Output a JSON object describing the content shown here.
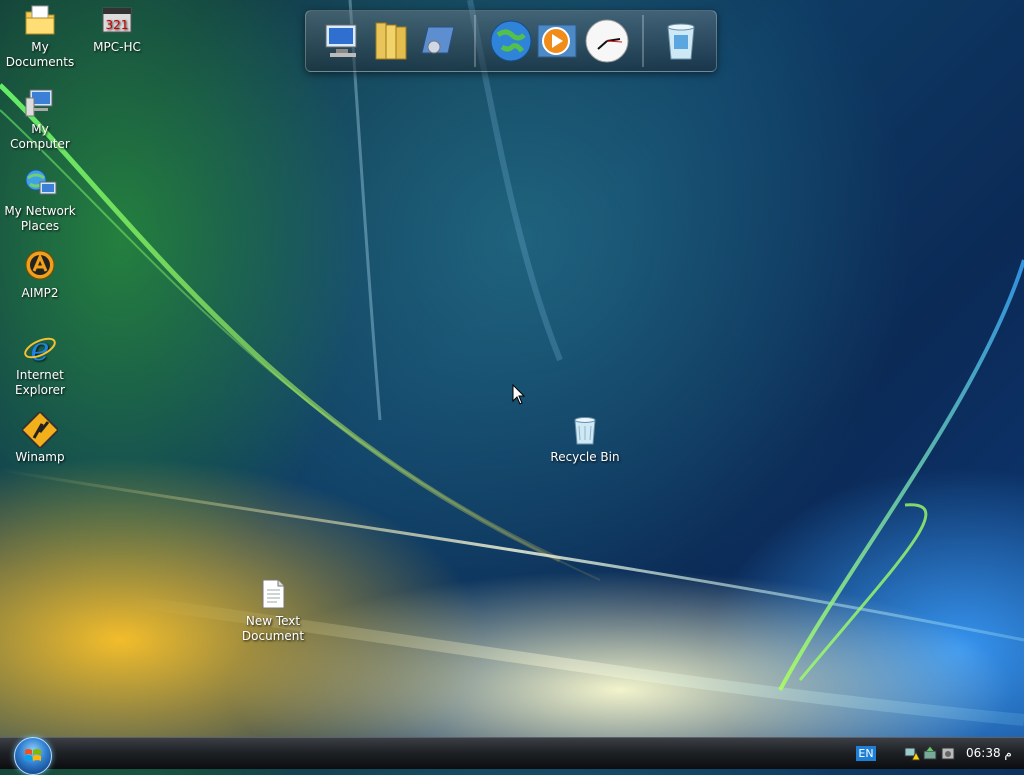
{
  "desktop": {
    "icons": [
      {
        "label": "My Documents",
        "icon": "my-documents-icon"
      },
      {
        "label": "MPC-HC",
        "icon": "mpc-hc-icon"
      },
      {
        "label": "My Computer",
        "icon": "my-computer-icon"
      },
      {
        "label": "My Network Places",
        "icon": "network-places-icon"
      },
      {
        "label": "AIMP2",
        "icon": "aimp2-icon"
      },
      {
        "label": "Internet Explorer",
        "icon": "internet-explorer-icon"
      },
      {
        "label": "Winamp",
        "icon": "winamp-icon"
      },
      {
        "label": "Recycle Bin",
        "icon": "recycle-bin-icon"
      },
      {
        "label": "New Text Document",
        "icon": "text-document-icon"
      }
    ]
  },
  "dock": {
    "items": [
      "computer-icon",
      "folders-icon",
      "drive-icon",
      "globe-icon",
      "media-player-icon",
      "clock-icon",
      "trash-icon"
    ]
  },
  "taskbar": {
    "start_icon": "windows-orb-icon",
    "language": "EN",
    "clock": "06:38 م"
  },
  "colors": {
    "taskbar": "#1f2226",
    "lang_badge": "#1e7fd6",
    "desktop_blue": "#0b2a56",
    "desktop_green": "#2f8a3a",
    "desktop_yellow": "#ffc428"
  }
}
